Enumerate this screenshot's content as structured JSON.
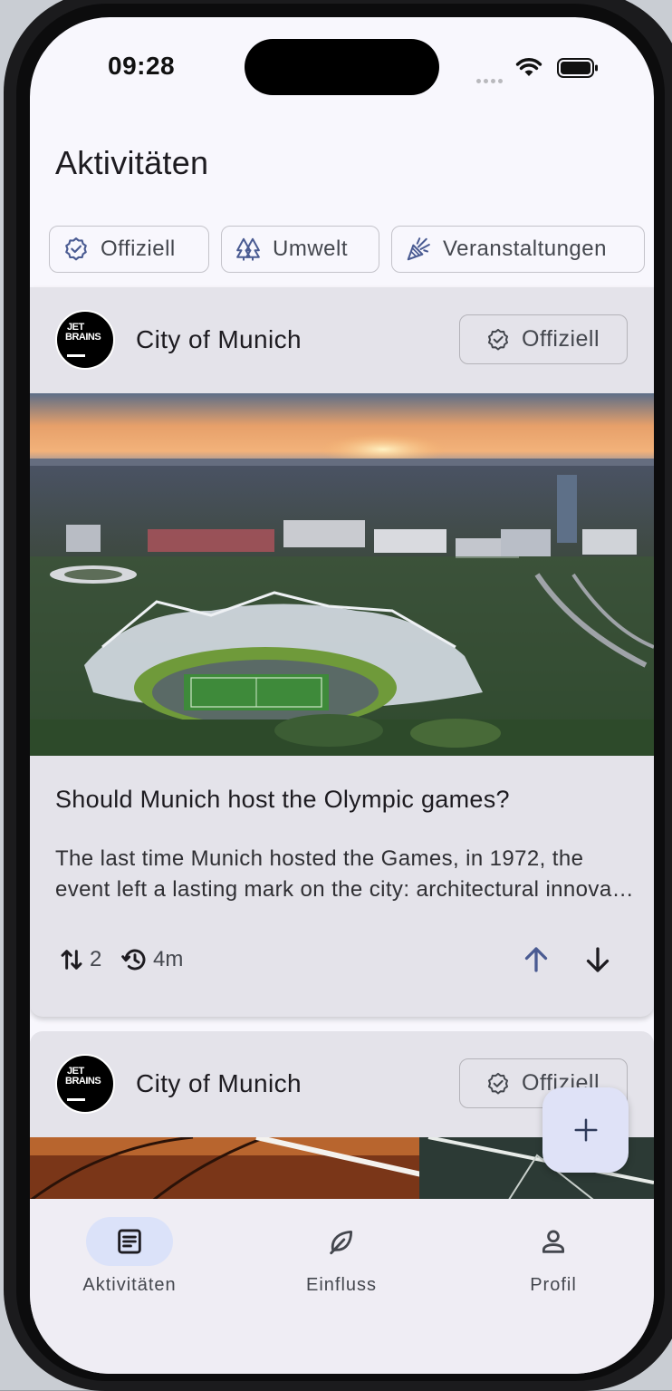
{
  "status_bar": {
    "time": "09:28"
  },
  "page": {
    "title": "Aktivitäten"
  },
  "filters": [
    {
      "label": "Offiziell",
      "icon": "verified-badge-icon"
    },
    {
      "label": "Umwelt",
      "icon": "trees-icon"
    },
    {
      "label": "Veranstaltungen",
      "icon": "party-popper-icon"
    }
  ],
  "posts": [
    {
      "author": "City of Munich",
      "avatar_text_1": "JET",
      "avatar_text_2": "BRAINS",
      "badge": "Offiziell",
      "title": "Should Munich host the Olympic games?",
      "body_line_1": "The last time Munich hosted the Games, in 1972, the",
      "body_line_2": "event left a lasting mark on the city: architectural innovations, and",
      "votes": "2",
      "age": "4m"
    },
    {
      "author": "City of Munich",
      "avatar_text_1": "JET",
      "avatar_text_2": "BRAINS",
      "badge": "Offiziell"
    }
  ],
  "fab": {
    "icon": "plus-icon"
  },
  "nav": [
    {
      "label": "Aktivitäten",
      "icon": "article-icon",
      "active": true
    },
    {
      "label": "Einfluss",
      "icon": "leaf-icon",
      "active": false
    },
    {
      "label": "Profil",
      "icon": "person-icon",
      "active": false
    }
  ],
  "colors": {
    "accent": "#4a5b92",
    "surface": "#f8f7fd",
    "card": "#e4e3ea",
    "nav_active": "#dbe2f9"
  }
}
